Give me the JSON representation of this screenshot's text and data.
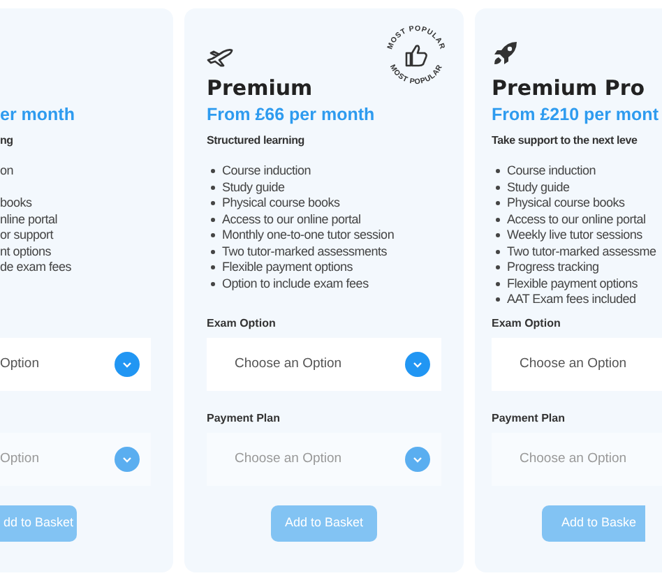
{
  "plans": [
    {
      "price": "er month",
      "tagline": "ng",
      "features": [
        "on",
        "books",
        "nline portal",
        "or support",
        "nt options",
        "de exam fees"
      ],
      "exam_option": {
        "placeholder": "Option",
        "disabled": false
      },
      "payment_plan": {
        "placeholder": "Option",
        "disabled": true
      },
      "button": {
        "label": "dd to Basket",
        "disabled": true
      }
    },
    {
      "badge": {
        "top": "MOST POPULAR",
        "bottom": "MOST POPULAR"
      },
      "name": "Premium",
      "price": "From £66 per month",
      "tagline": "Structured learning",
      "features": [
        "Course induction",
        "Study guide",
        "Physical course books",
        "Access to our online portal",
        "Monthly one-to-one tutor session",
        "Two tutor-marked assessments",
        "Flexible payment options",
        "Option to include exam fees"
      ],
      "exam_option": {
        "label": "Exam Option",
        "placeholder": "Choose an Option",
        "disabled": false
      },
      "payment_plan": {
        "label": "Payment Plan",
        "placeholder": "Choose an Option",
        "disabled": true
      },
      "button": {
        "label": "Add to Basket",
        "disabled": true
      }
    },
    {
      "name": "Premium Pro",
      "price": "From £210 per mont",
      "tagline": "Take support to the next leve",
      "features": [
        "Course induction",
        "Study guide",
        "Physical course books",
        "Access to our online portal",
        "Weekly live tutor sessions",
        "Two tutor-marked assessme",
        "Progress tracking",
        "Flexible payment options",
        "AAT Exam fees included"
      ],
      "exam_option": {
        "label": "Exam Option",
        "placeholder": "Choose an Option",
        "disabled": false
      },
      "payment_plan": {
        "label": "Payment Plan",
        "placeholder": "Choose an Option",
        "disabled": true
      },
      "button": {
        "label": "Add to Baske",
        "disabled": true
      }
    }
  ]
}
